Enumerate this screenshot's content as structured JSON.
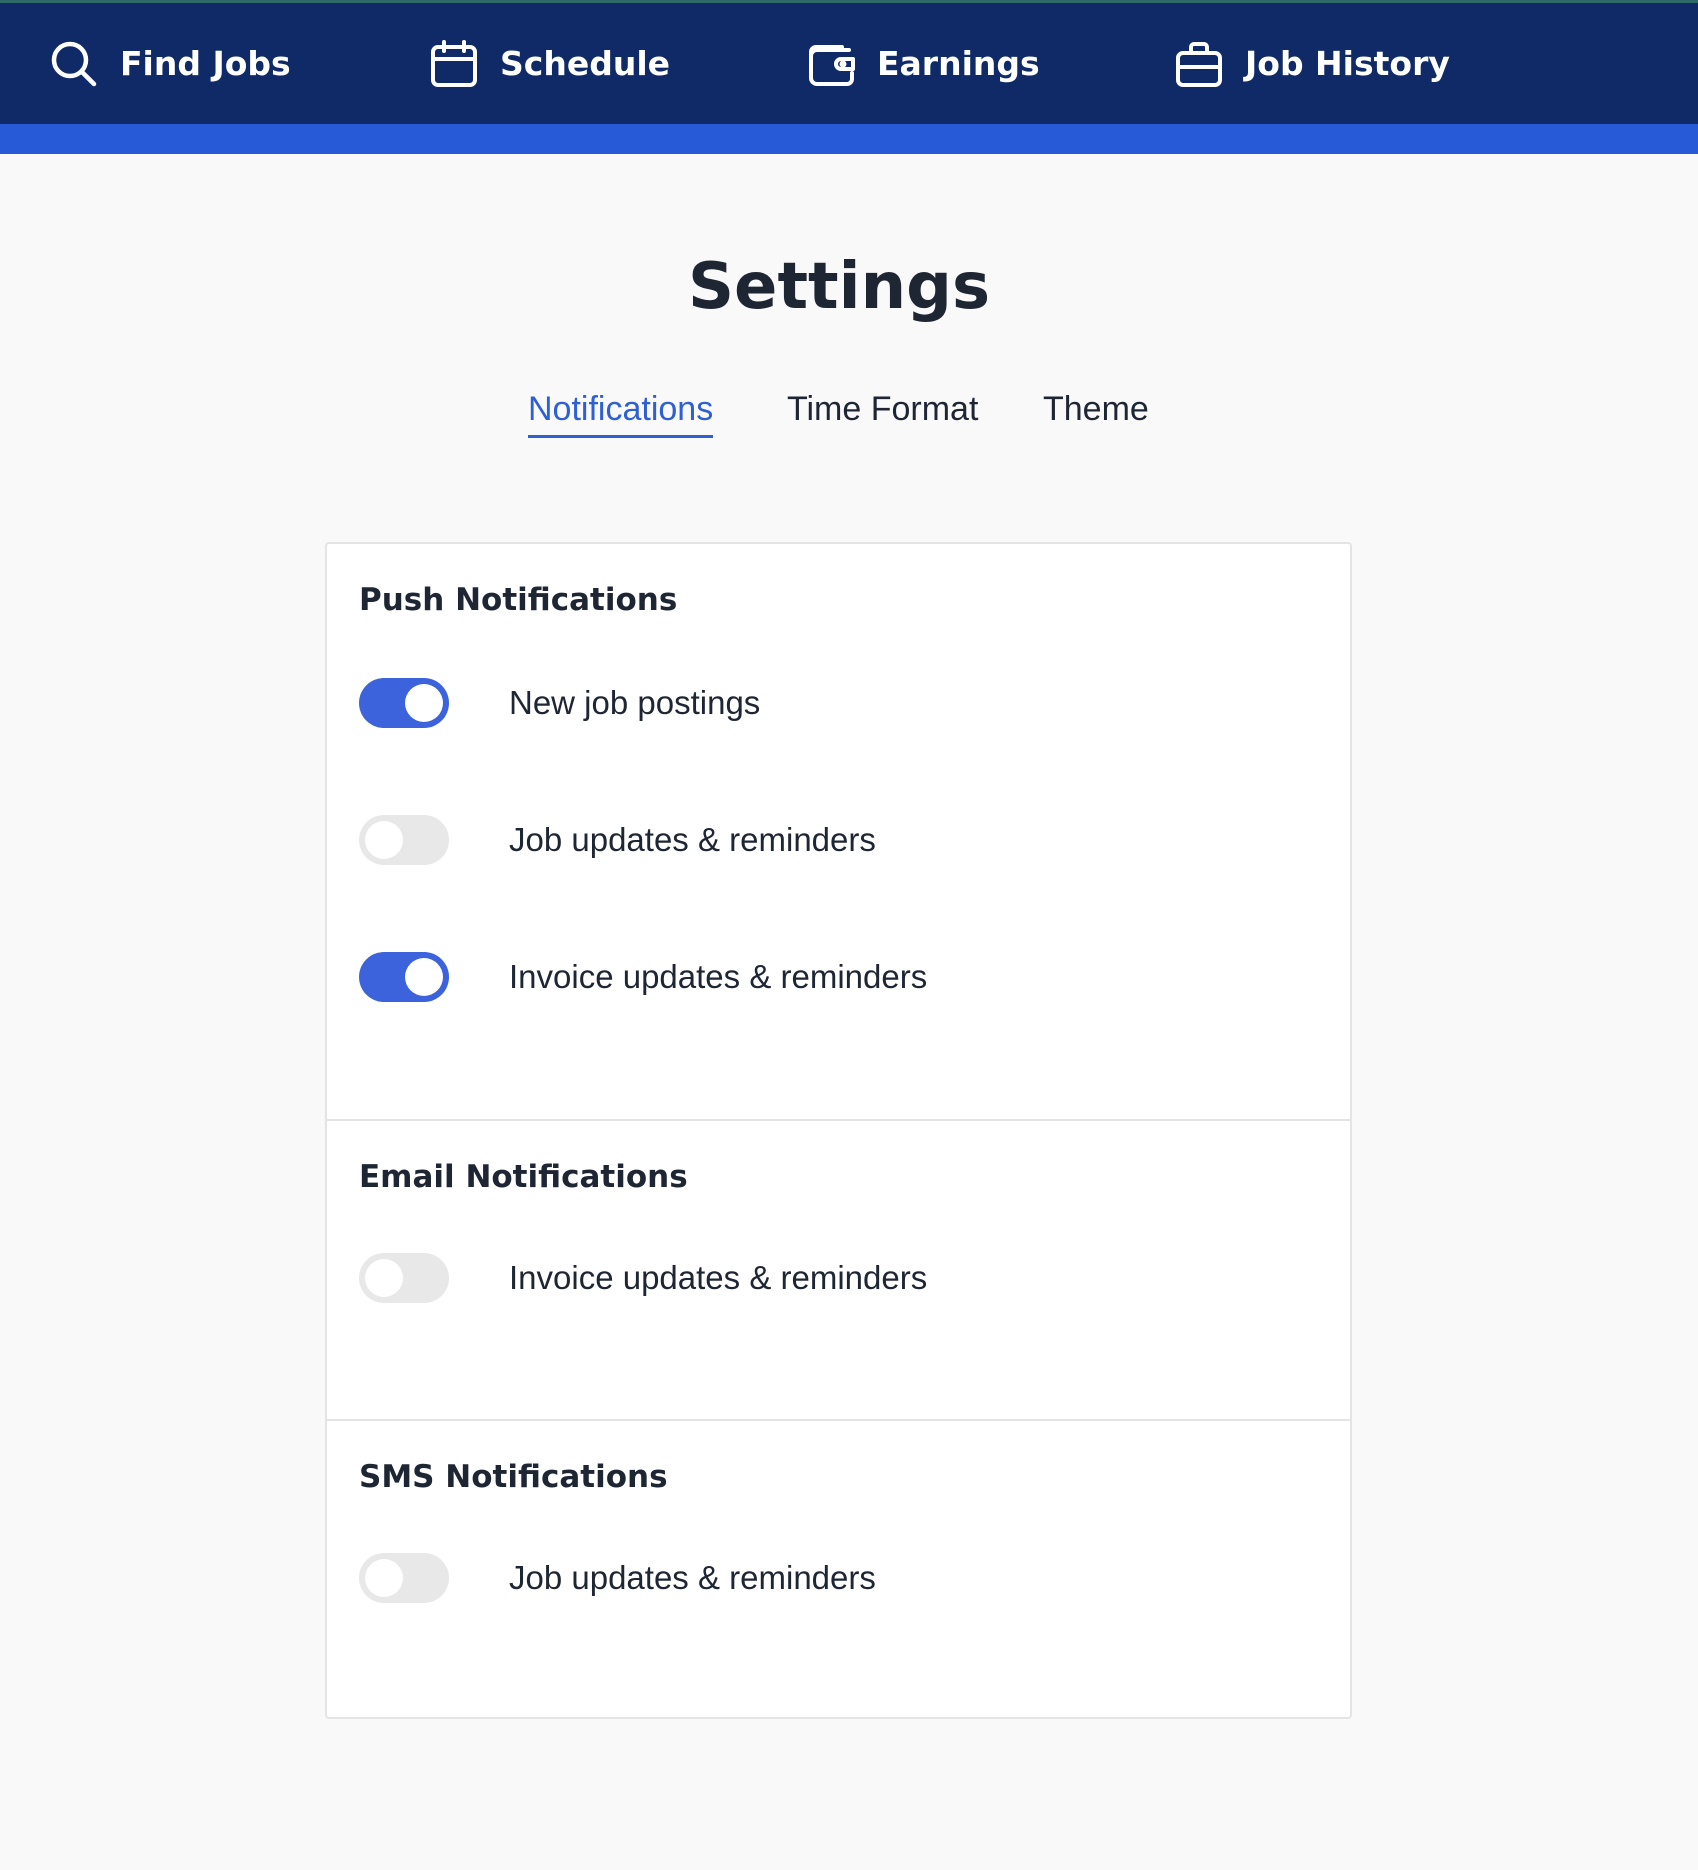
{
  "nav": {
    "items": [
      {
        "label": "Find Jobs",
        "icon": "search-icon"
      },
      {
        "label": "Schedule",
        "icon": "calendar-icon"
      },
      {
        "label": "Earnings",
        "icon": "wallet-icon"
      },
      {
        "label": "Job History",
        "icon": "briefcase-icon"
      }
    ]
  },
  "page": {
    "title": "Settings"
  },
  "tabs": [
    {
      "label": "Notifications",
      "active": true
    },
    {
      "label": "Time Format",
      "active": false
    },
    {
      "label": "Theme",
      "active": false
    }
  ],
  "sections": {
    "push": {
      "title": "Push Notifications",
      "rows": [
        {
          "label": "New job postings",
          "enabled": true
        },
        {
          "label": "Job updates & reminders",
          "enabled": false
        },
        {
          "label": "Invoice updates & reminders",
          "enabled": true
        }
      ]
    },
    "email": {
      "title": "Email Notifications",
      "rows": [
        {
          "label": "Invoice updates & reminders",
          "enabled": false
        }
      ]
    },
    "sms": {
      "title": "SMS Notifications",
      "rows": [
        {
          "label": "Job updates & reminders",
          "enabled": false
        }
      ]
    }
  },
  "colors": {
    "nav_bg": "#0f2a66",
    "accent_bar": "#275ad6",
    "toggle_on": "#3c62dc",
    "toggle_off": "#e8e8e8",
    "active_tab": "#2e5fd3"
  }
}
